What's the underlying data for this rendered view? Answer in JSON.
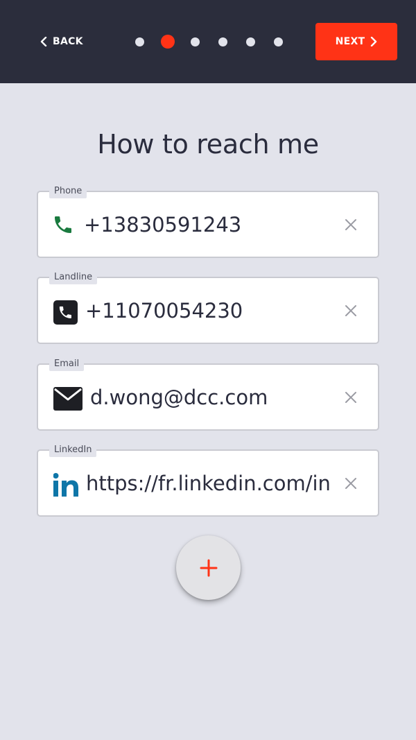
{
  "nav": {
    "back_label": "BACK",
    "next_label": "NEXT",
    "steps_total": 6,
    "current_step": 2
  },
  "page": {
    "title": "How to reach me"
  },
  "fields": [
    {
      "label": "Phone",
      "value": "+13830591243",
      "icon": "phone-icon"
    },
    {
      "label": "Landline",
      "value": "+11070054230",
      "icon": "landline-icon"
    },
    {
      "label": "Email",
      "value": "d.wong@dcc.com",
      "icon": "email-icon"
    },
    {
      "label": "LinkedIn",
      "value": "https://fr.linkedin.com/in",
      "icon": "linkedin-icon"
    }
  ],
  "add_button": {
    "label": "+"
  },
  "colors": {
    "accent": "#ff3316",
    "topbar": "#2b2d3c",
    "background": "#e2e3eb",
    "phone_icon": "#1a7a3f",
    "linkedin_icon": "#0e76a8",
    "clear_icon": "#9a9ba3"
  }
}
